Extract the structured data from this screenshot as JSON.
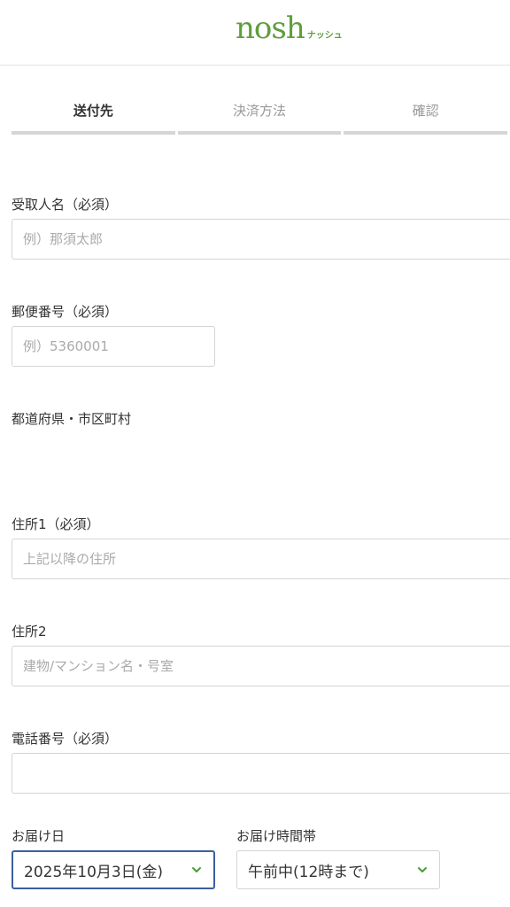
{
  "header": {
    "logo_main": "nosh",
    "logo_kana": "ナッシュ"
  },
  "steps": [
    {
      "label": "送付先",
      "active": true
    },
    {
      "label": "決済方法",
      "active": false
    },
    {
      "label": "確認",
      "active": false
    }
  ],
  "form": {
    "recipient": {
      "label": "受取人名（必須）",
      "placeholder": "例）那須太郎",
      "value": ""
    },
    "postal": {
      "label": "郵便番号（必須）",
      "placeholder": "例）5360001",
      "value": ""
    },
    "prefecture": {
      "label": "都道府県・市区町村"
    },
    "address1": {
      "label": "住所1（必須）",
      "placeholder": "上記以降の住所",
      "value": ""
    },
    "address2": {
      "label": "住所2",
      "placeholder": "建物/マンション名・号室",
      "value": ""
    },
    "phone": {
      "label": "電話番号（必須）",
      "placeholder": "",
      "value": ""
    },
    "delivery_date": {
      "label": "お届け日",
      "value": "2025年10月3日(金)"
    },
    "delivery_time": {
      "label": "お届け時間帯",
      "value": "午前中(12時まで)"
    }
  },
  "colors": {
    "brand_green": "#5f9e3c",
    "focus_blue": "#3b5fa0",
    "chevron_green": "#4a9a3a"
  },
  "icons": {
    "select_chevron": "chevron-down-icon"
  }
}
